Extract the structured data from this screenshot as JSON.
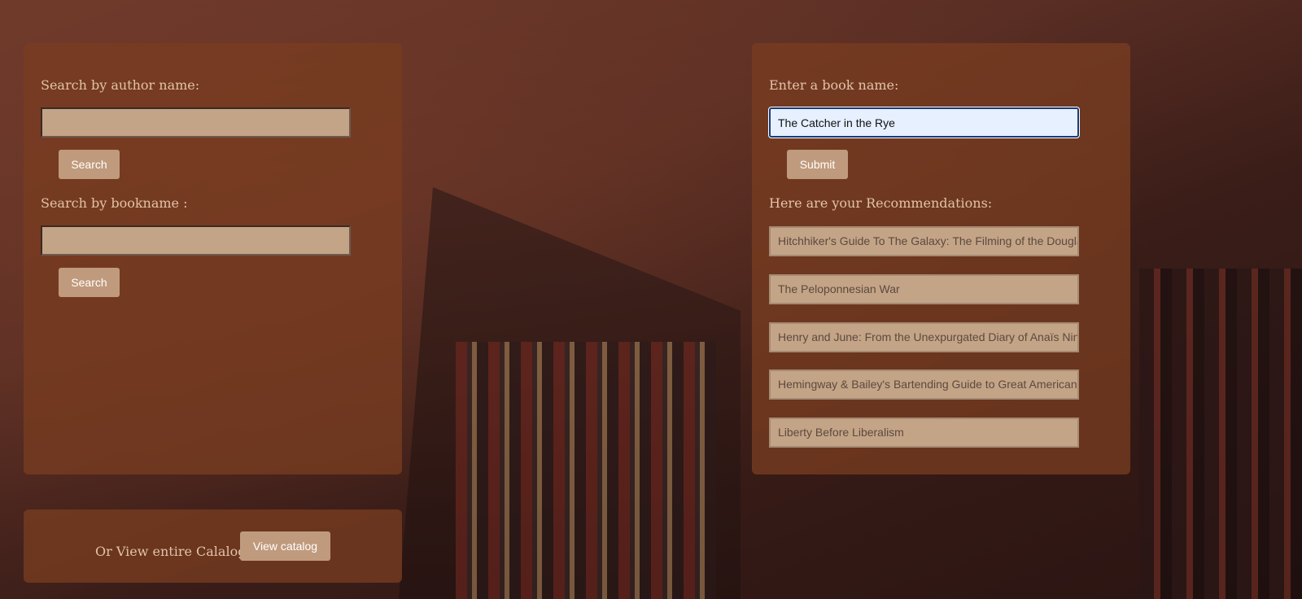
{
  "author_search": {
    "label": "Search by author name:",
    "value": "",
    "button_label": "Search"
  },
  "bookname_search": {
    "label": "Search by bookname :",
    "value": "",
    "button_label": "Search"
  },
  "recommender": {
    "label": "Enter a book name:",
    "value": "The Catcher in the Rye",
    "button_label": "Submit",
    "results_label": "Here are your Recommendations:",
    "results": [
      "Hitchhiker's Guide To The Galaxy: The Filming of the Douglas Adams Classic",
      "The Peloponnesian War",
      "Henry and June: From the Unexpurgated Diary of Anaïs Nin",
      "Hemingway & Bailey's Bartending Guide to Great American Writers",
      "Liberty Before Liberalism"
    ]
  },
  "catalog": {
    "label": "Or View entire Calalog",
    "button_label": "View catalog"
  },
  "colors": {
    "panel": "#78401f",
    "button": "#c09a7c",
    "input": "#c4a486",
    "focused_input": "#e6f0ff",
    "label_text": "#e2c3a8"
  }
}
